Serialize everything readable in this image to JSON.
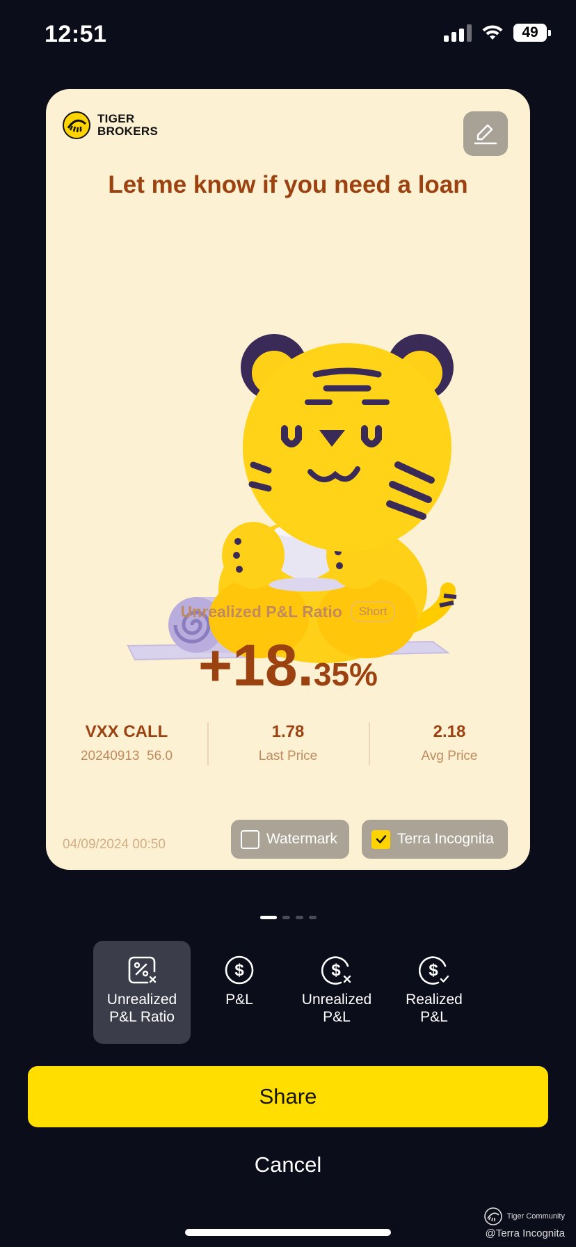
{
  "status_bar": {
    "time": "12:51",
    "battery": "49"
  },
  "card": {
    "brand": {
      "line1": "TIGER",
      "line2": "BROKERS"
    },
    "headline": "Let me know if you need a loan",
    "ratio_label": "Unrealized P&L Ratio",
    "position_badge": "Short",
    "value_main": "+18.",
    "value_fraction": "35%",
    "stats": [
      {
        "top": "VXX CALL",
        "bottom": "20240913  56.0"
      },
      {
        "top": "1.78",
        "bottom": "Last Price"
      },
      {
        "top": "2.18",
        "bottom": "Avg Price"
      }
    ],
    "date": "04/09/2024 00:50",
    "toggles": {
      "watermark": {
        "label": "Watermark",
        "checked": false
      },
      "terra": {
        "label": "Terra Incognita",
        "checked": true
      }
    }
  },
  "pager": {
    "pages": 4,
    "active": 0
  },
  "tabs": [
    {
      "line1": "Unrealized",
      "line2": "P&L Ratio",
      "icon": "percent-tag-icon",
      "active": true
    },
    {
      "line1": "P&L",
      "line2": "",
      "icon": "dollar-circle-icon",
      "active": false
    },
    {
      "line1": "Unrealized",
      "line2": "P&L",
      "icon": "dollar-x-icon",
      "active": false
    },
    {
      "line1": "Realized",
      "line2": "P&L",
      "icon": "dollar-check-icon",
      "active": false
    }
  ],
  "share_label": "Share",
  "cancel_label": "Cancel",
  "community": {
    "name": "Tiger Community",
    "handle": "@Terra Incognita"
  },
  "colors": {
    "accent": "#ffde00",
    "card_bg": "#fdf1d3",
    "value_text": "#9c4210",
    "page_bg": "#0c0d1a"
  }
}
